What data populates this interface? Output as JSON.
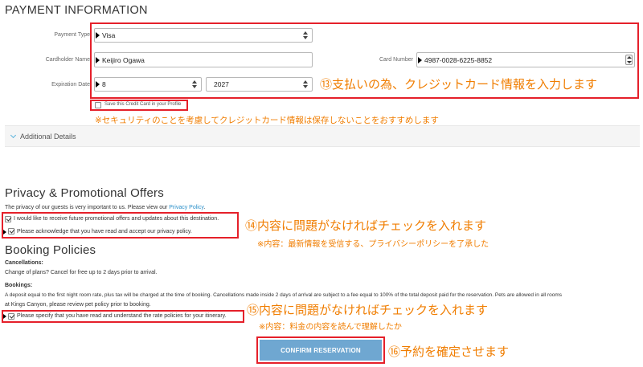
{
  "payment": {
    "title": "PAYMENT INFORMATION",
    "payment_type_label": "Payment Type",
    "payment_type_value": "Visa",
    "cardholder_label": "Cardholder Name",
    "cardholder_value": "Keijiro Ogawa",
    "card_number_label": "Card Number",
    "card_number_value": "4987-0028-6225-8852",
    "expiration_label": "Expiration Date",
    "exp_month": "8",
    "exp_year": "2027",
    "save_card_label": "Save this Credit Card in your Profile"
  },
  "annotations": {
    "a13": "⑬支払いの為、クレジットカード情報を入力します",
    "security_note": "※セキュリティのことを考慮してクレジットカード情報は保存しないことをおすすめします",
    "a14": "⑭内容に問題がなければチェックを入れます",
    "a14_note": "※内容：最新情報を受信する、プライバシーポリシーを了承した",
    "a15": "⑮内容に問題がなければチェックを入れます",
    "a15_note": "※内容：料金の内容を読んで理解したか",
    "a16": "⑯予約を確定させます"
  },
  "additional_details": {
    "label": "Additional Details"
  },
  "privacy": {
    "title": "Privacy & Promotional Offers",
    "intro_prefix": "The privacy of our guests is very important to us. Please view our ",
    "intro_link": "Privacy Policy",
    "intro_suffix": ".",
    "promo_checkbox": "I would like to receive future promotional offers and updates about this destination.",
    "policy_checkbox": "Please acknowledge that you have read and accept our privacy policy."
  },
  "booking": {
    "title": "Booking Policies",
    "cancellations_heading": "Cancellations:",
    "cancellations_text": "Change of plans? Cancel for free up to 2 days prior to arrival.",
    "bookings_heading": "Bookings:",
    "bookings_text_line1": "A deposit equal to the first night room rate, plus tax will be charged at the time of booking. Cancellations made inside 2 days of arrival are subject to a fee equal to 100% of the total deposit paid for the reservation. Pets are allowed in all rooms",
    "bookings_text_line2": "at Kings Canyon, please review pet policy prior to booking.",
    "rate_checkbox": "Please specify that you have read and understand the rate policies for your itinerary."
  },
  "confirm_button": "CONFIRM RESERVATION",
  "colors": {
    "annotation": "#f07d00",
    "highlight_frame": "#e5202a",
    "button": "#6fa7d1",
    "link": "#2a8fc9"
  }
}
